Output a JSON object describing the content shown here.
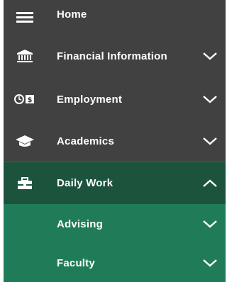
{
  "nav": {
    "home": {
      "label": "Home",
      "icon": "menu-icon"
    },
    "financial": {
      "label": "Financial Information",
      "icon": "bank-icon"
    },
    "employment": {
      "label": "Employment",
      "icon": "timesheet-icon"
    },
    "academics": {
      "label": "Academics",
      "icon": "graduation-cap-icon"
    },
    "daily_work": {
      "label": "Daily Work",
      "icon": "briefcase-icon"
    },
    "advising": {
      "label": "Advising"
    },
    "faculty": {
      "label": "Faculty"
    }
  },
  "colors": {
    "nav_background": "#414141",
    "active_background": "#1c533d",
    "submenu_background": "#207c58",
    "text": "#ffffff"
  }
}
